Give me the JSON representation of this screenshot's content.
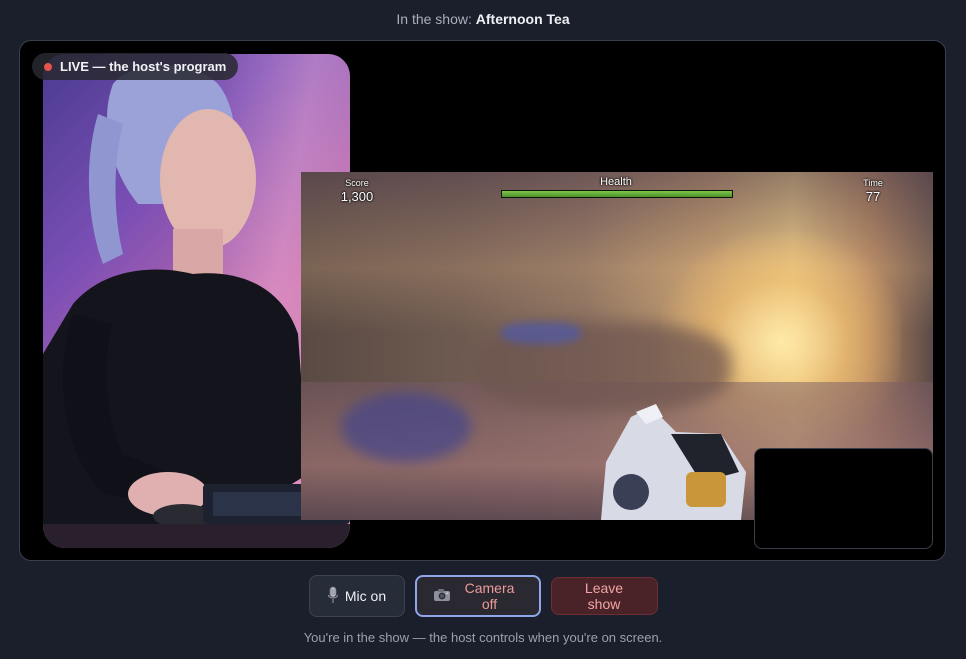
{
  "header": {
    "prefix": "In the show:",
    "show_name": "Afternoon Tea"
  },
  "stage": {
    "live_badge": "LIVE — the host's program",
    "game_hud": {
      "score_label": "Score",
      "score_value": "1,300",
      "health_label": "Health",
      "health_level_percent": 100,
      "time_label": "Time",
      "time_value": "77"
    }
  },
  "controls": {
    "mic_label": "Mic on",
    "mic_icon": "microphone-icon",
    "camera_label": "Camera off",
    "camera_icon": "camera-icon",
    "leave_label": "Leave show"
  },
  "footer": {
    "status": "You're in the show — the host controls when you're on screen."
  },
  "colors": {
    "live_dot": "#e5534b",
    "camera_focus_ring": "#8fa6e8",
    "leave_bg": "#4a2329"
  }
}
